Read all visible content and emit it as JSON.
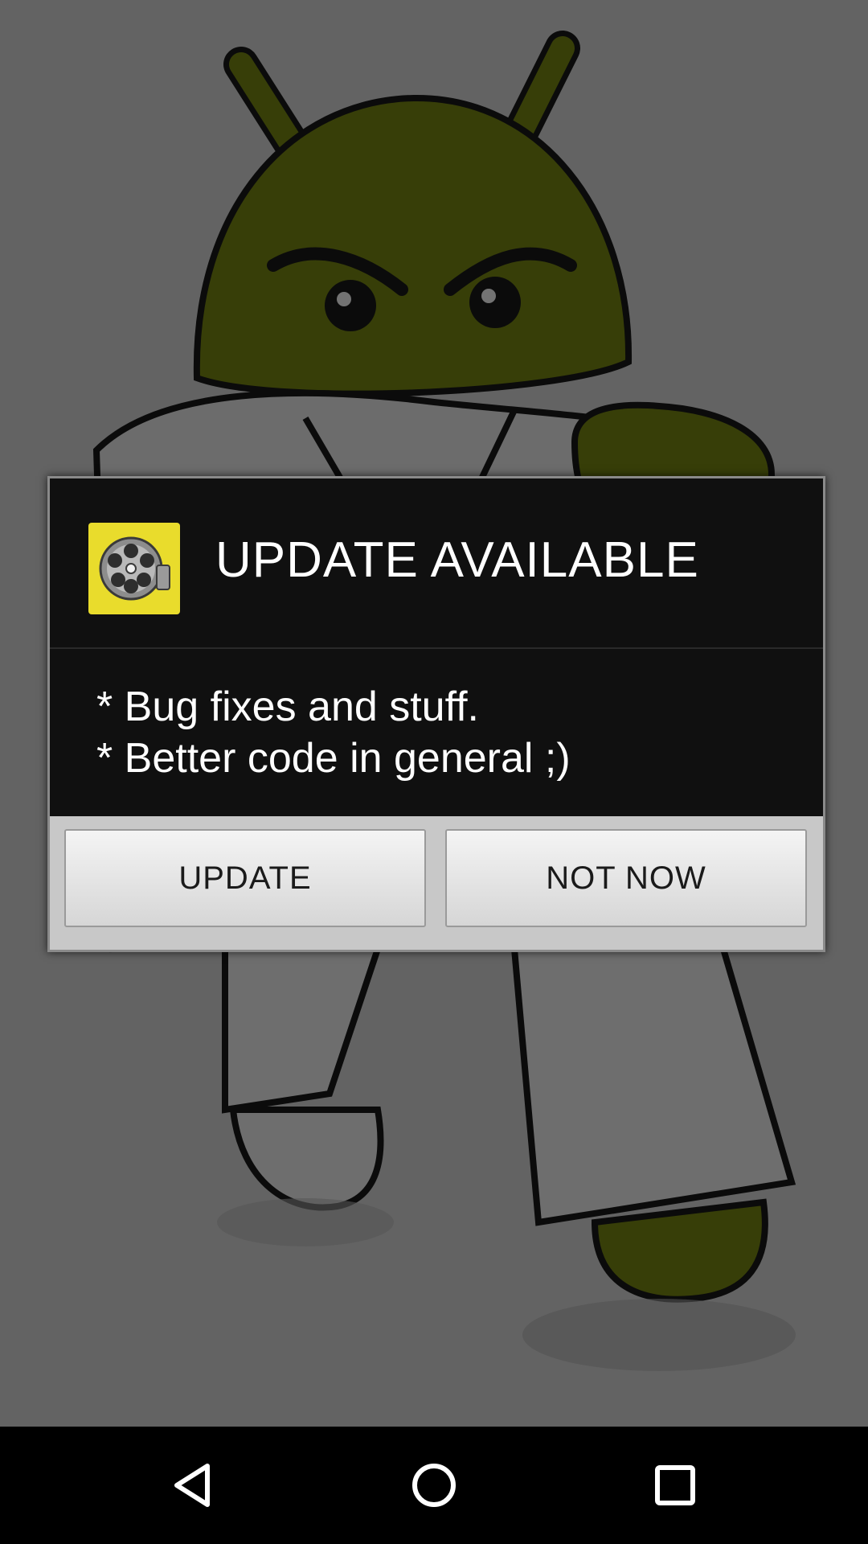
{
  "dialog": {
    "title": "UPDATE AVAILABLE",
    "icon": "film-reel-icon",
    "message_lines": [
      "* Bug fixes and stuff.",
      "* Better code in general ;)"
    ],
    "buttons": {
      "update_label": "UPDATE",
      "not_now_label": "NOT NOW"
    }
  },
  "navbar": {
    "back": "back-icon",
    "home": "home-icon",
    "recents": "recents-icon"
  },
  "colors": {
    "dialog_background": "#101010",
    "icon_background": "#e9dc2c",
    "mascot_green": "#7a8a12"
  }
}
